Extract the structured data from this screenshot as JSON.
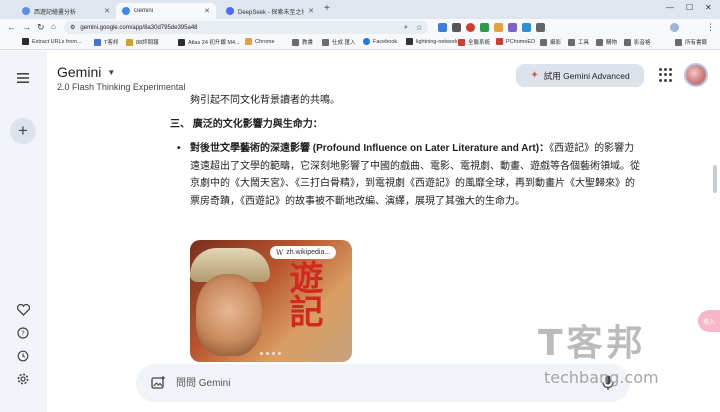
{
  "browser": {
    "tabs": [
      {
        "label": "西遊記繪畫分析",
        "color": "#5b8def",
        "active": false
      },
      {
        "label": "Gemini",
        "color": "#4285f4",
        "active": true
      },
      {
        "label": "DeepSeek - 探索未至之境",
        "color": "#4d6bfe",
        "active": false
      }
    ],
    "url": "gemini.google.com/app/8a30d795de395a48",
    "bookmarks": [
      {
        "label": "Extract URLs from...",
        "color": "#2b2b2b"
      },
      {
        "label": "T客邦",
        "color": "#4a6fd6"
      },
      {
        "label": "88評問報",
        "color": "#d0a02a"
      },
      {
        "label": "Atlas 24 初升鍍 M4...",
        "color": "#2d2d2d"
      },
      {
        "label": "Chrome",
        "color": "#e8a03b"
      },
      {
        "label": "教書",
        "color": "#6b6b6b"
      },
      {
        "label": "仕成 匯入",
        "color": "#6b6b6b"
      },
      {
        "label": "Facebook",
        "color": "#1877f2"
      },
      {
        "label": "lightning-network",
        "color": "#333"
      },
      {
        "label": "全聯系統",
        "color": "#d23b2f"
      },
      {
        "label": "PChomeED",
        "color": "#d23b2f"
      },
      {
        "label": "攝影",
        "color": "#6b6b6b"
      },
      {
        "label": "工具",
        "color": "#6b6b6b"
      },
      {
        "label": "購物",
        "color": "#6b6b6b"
      },
      {
        "label": "影音格",
        "color": "#6b6b6b"
      },
      {
        "label": "所有書籤",
        "color": "#6b6b6b"
      }
    ]
  },
  "app": {
    "name": "Gemini",
    "model": "2.0 Flash Thinking Experimental",
    "advanced_button": "試用 Gemini Advanced",
    "input_placeholder": "問問 Gemini"
  },
  "response": {
    "truncated_top": "夠引起不同文化背景讀者的共鳴。",
    "section_heading": "三、 廣泛的文化影響力與生命力：",
    "bullet_title": "對後世文學藝術的深遠影響 (Profound Influence on Later Literature and Art)：",
    "bullet_text": "《西遊記》的影響力遠遠超出了文學的範疇，它深刻地影響了中國的戲曲、電影、電視劇、動畫、遊戲等各個藝術領域。從京劇中的《大鬧天宮》、《三打白骨精》，到電視劇《西遊記》的風靡全球，再到動畫片《大聖歸來》的票房奇蹟，《西遊記》的故事被不斷地改編、演繹，展現了其強大的生命力。",
    "image_source": "zh.wikipedia...",
    "poster_chars": "遊記"
  },
  "watermark": {
    "title": "T客邦",
    "sub": "techbang.com"
  },
  "side_chip": "塔入"
}
